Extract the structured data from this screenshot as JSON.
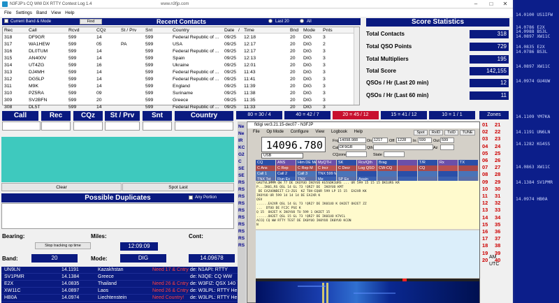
{
  "window": {
    "title": "N3FJP's CQ WW DX RTTY Contest Log 1.4",
    "url": "www.n3fjp.com"
  },
  "menu": [
    "File",
    "Settings",
    "Band",
    "View",
    "Help"
  ],
  "recent": {
    "checkbox_label": "Current Band & Mode",
    "find_label": "Find",
    "title": "Recent Contacts",
    "radio_last20": "Last 20",
    "radio_all": "All",
    "columns": [
      "Rec",
      "Call",
      "Rcvd",
      "CQz",
      "St / Prv",
      "Snt",
      "Country",
      "Date",
      "/",
      "Time",
      "Bnd",
      "Mode",
      "Pnts"
    ],
    "rows": [
      [
        "318",
        "DF9GR",
        "599",
        "14",
        "",
        "599",
        "Federal Republic of ...",
        "09/25",
        "12:18",
        "20",
        "DIG",
        "3"
      ],
      [
        "317",
        "WA1HEW",
        "599",
        "05",
        "PA",
        "599",
        "USA",
        "09/25",
        "12:17",
        "20",
        "DIG",
        "2"
      ],
      [
        "316",
        "DL0TUM",
        "599",
        "14",
        "",
        "599",
        "Federal Republic of ...",
        "09/25",
        "12:17",
        "20",
        "DIG",
        "3"
      ],
      [
        "315",
        "AN400V",
        "599",
        "14",
        "",
        "599",
        "Spain",
        "09/25",
        "12:13",
        "20",
        "DIG",
        "3"
      ],
      [
        "314",
        "UT4ZG",
        "599",
        "16",
        "",
        "599",
        "Ukraine",
        "09/25",
        "12:01",
        "20",
        "DIG",
        "3"
      ],
      [
        "313",
        "DJ4MH",
        "599",
        "14",
        "",
        "599",
        "Federal Republic of ...",
        "09/25",
        "11:43",
        "20",
        "DIG",
        "3"
      ],
      [
        "312",
        "DG5LP",
        "599",
        "14",
        "",
        "599",
        "Federal Republic of ...",
        "09/25",
        "11:41",
        "20",
        "DIG",
        "3"
      ],
      [
        "311",
        "M9K",
        "599",
        "14",
        "",
        "599",
        "England",
        "09/25",
        "11:39",
        "20",
        "DIG",
        "3"
      ],
      [
        "310",
        "PZ5RA",
        "599",
        "09",
        "",
        "599",
        "Suriname",
        "09/25",
        "11:38",
        "20",
        "DIG",
        "3"
      ],
      [
        "309",
        "SV2BFN",
        "599",
        "20",
        "",
        "599",
        "Greece",
        "09/25",
        "11:35",
        "20",
        "DIG",
        "3"
      ],
      [
        "308",
        "DL5T",
        "599",
        "14",
        "",
        "599",
        "Federal Republic of ...",
        "09/25",
        "11:33",
        "20",
        "DIG",
        "3"
      ]
    ]
  },
  "scores": {
    "title": "Score Statistics",
    "items": [
      {
        "label": "Total Contacts",
        "value": "318"
      },
      {
        "label": "Total QSO Points",
        "value": "729"
      },
      {
        "label": "Total Multipliers",
        "value": "195"
      },
      {
        "label": "Total Score",
        "value": "142,155"
      },
      {
        "label": "QSOs / Hr (Last 20 min)",
        "value": "12"
      },
      {
        "label": "QSOs / Hr (Last 60 min)",
        "value": "11"
      }
    ]
  },
  "entry": {
    "labels": [
      "Call",
      "Rec",
      "CQz",
      "St / Prv",
      "Snt",
      "Country"
    ]
  },
  "buttons": {
    "clear": "Clear",
    "spot_last": "Spot Last",
    "stop_tracking": "Stop tracking op time"
  },
  "duplicates": {
    "title": "Possible Duplicates",
    "any_portion": "Any Portion"
  },
  "status": {
    "bearing_label": "Bearing:",
    "miles_label": "Miles:",
    "cont_label": "Cont:",
    "time": "12:09:09",
    "band_label": "Band:",
    "band": "20",
    "mode_label": "Mode:",
    "mode": "DIG",
    "freq": "14.09678"
  },
  "band_tabs": [
    {
      "label": "80 = 30 / 4",
      "color": "#0a1a80"
    },
    {
      "label": "40 = 42 / 7",
      "color": "#0a1a80"
    },
    {
      "label": "20 = 45 / 12",
      "color": "#c8102e"
    },
    {
      "label": "15 = 41 / 12",
      "color": "#0a1a80"
    },
    {
      "label": "10 = 1 / 1",
      "color": "#0a1a80"
    }
  ],
  "zones": {
    "label": "Zones",
    "col1": [
      "01",
      "02",
      "03",
      "04",
      "05",
      "06",
      "07",
      "08",
      "09",
      "10",
      "11",
      "12",
      "13",
      "14",
      "15",
      "16",
      "17",
      "18",
      "19",
      "20"
    ],
    "col2": [
      "21",
      "22",
      "23",
      "24",
      "25",
      "26",
      "27",
      "28",
      "29",
      "30",
      "31",
      "32",
      "33",
      "34",
      "35",
      "36",
      "37",
      "38",
      "39",
      "40"
    ],
    "am": "AM",
    "utc": "UTC"
  },
  "packet": [
    [
      "UN9LN",
      "14.1191",
      "Kazakhstan",
      "Need 17 & Cntry!",
      "de: N1API: RTTY"
    ],
    [
      "SV1PMR",
      "14.1384",
      "Greece",
      "",
      "de: N3QE: CQ WW"
    ],
    [
      "E2X",
      "14.0835",
      "Thailand",
      "Need 26 & Cntry!",
      "de: W3FIZ: QSX 140"
    ],
    [
      "XW11C",
      "14.0897",
      "Laos",
      "Need 26 & Cntry!",
      "de: W3LPL: RTTY He"
    ],
    [
      "HB0A",
      "14.0974",
      "Liechtenstein",
      "Need Country!",
      "de: W3LPL: RTTY He"
    ]
  ],
  "fldigi": {
    "title": "fldigi ver3.21.15-dec07 - N3FJP",
    "menu": [
      "File",
      "Op Mode",
      "Configure",
      "View",
      "Logbook",
      "Help"
    ],
    "frequency": "14096.780",
    "mode": "USB",
    "frq_value": "14098.988",
    "call_value": "DF9GR",
    "on_label": "On",
    "on_value": "1217",
    "off_label": "Off",
    "off_value": "1228",
    "in_label": "In",
    "in_value": "599",
    "out_label": "Out",
    "out_value": "599",
    "qth_label": "Qth",
    "st_label": "St",
    "pr_label": "Pr",
    "az_label": "Az",
    "cqzone_label": "CQzone",
    "state_label": "State",
    "frq_label": "Frq",
    "call_label": "Call",
    "buttons": [
      "Spot",
      "RxID",
      "TxID",
      "TUNE"
    ],
    "macros_row1": [
      "CQ",
      "ANS",
      "Him DE Me",
      "MyQTH",
      "SK",
      "Rcv/Qth",
      "Brag",
      "",
      "T/R",
      "Rx",
      "TX"
    ],
    "macros_row2": [
      "C Ans",
      "C Rep",
      "C Rep M",
      "C Incr",
      "C Decr",
      "Log QSO",
      "CW-CQ",
      "",
      "CQ",
      "",
      ""
    ],
    "macros_row3": [
      "Call 1",
      "Call 2",
      "Call 3",
      "TNX 599 M",
      "",
      "",
      "",
      "",
      "",
      "",
      ""
    ],
    "macros_row4": [
      "TNX Tst",
      "Run Ex",
      "TNX",
      "Me",
      "SP Ex",
      "Again",
      "",
      "",
      "",
      "",
      ""
    ],
    "rx_lines": [
      "GAGTVL3MMM QW 77 DE IKOYUO IKOYUO KG5SDK1URS ... UR 599 15 15 15 DK1URS KR",
      "P...IK01,RS QSL 14 GL 73 !QRZ? DE  IKOYUO KMT",
      " DE EA2UONDEIT C3-ZGS  KZ TOH-EQUR 599 LP 15 15  EA2XR KK",
      "IKOYUO UR 599 14 14 14 DE EA2XR K",
      "QSV",
      "......EA2XR QSL 14 GL 73 !QRZ? DE IK01UO K OH2ET OH2ET ZZ",
      "...  DTUO DE FC2C PSE K",
      "Q 15  OH2ET K IKOYUO TU 599 1 OH2ET 15",
      "......OH2ET QSL 15 GL 73 !QRZ? DE IK01UO K7VCL",
      "ACCQ CQ WW RTTY TEST DE IK0YUO IK0YUO IK0YUO KCON",
      "N"
    ]
  },
  "rstrip": [
    "Ne",
    "Ne",
    "IR",
    "KC",
    "G2",
    "C",
    "SE",
    "SE",
    "RS",
    "RS",
    "RS",
    "RS",
    "RS",
    "RS",
    "RS",
    "RS",
    "RS",
    "RS"
  ],
  "sidepanel": [
    "14.0100 US1IFW",
    "14.0786 E2X",
    "14.0988 BS3L",
    "14.0897 XW11C",
    "14.0835 E2X",
    "14.0786 BS3L",
    "14.0897 XW11C",
    "14.0974 GU4UW",
    "14.1109 YM7KA",
    "14.1191 UN6LN",
    "14.1282 KG4SS",
    "14.0863 XW11C",
    "14.1384 SV1PMR",
    "14.0974 HB0A"
  ],
  "colors": {
    "accent": "#0a1a80",
    "red": "#c8102e",
    "teal": "#3ec9be",
    "need": "#ff4040"
  }
}
